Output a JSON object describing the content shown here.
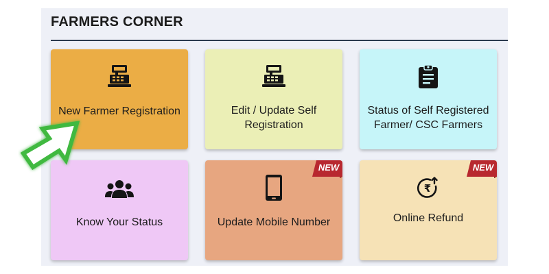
{
  "header": {
    "title": "FARMERS CORNER"
  },
  "tiles": [
    {
      "label": "New Farmer Registration",
      "icon": "cash-register-icon",
      "color": "#ebad45"
    },
    {
      "label": "Edit / Update Self Registration",
      "icon": "cash-register-icon",
      "color": "#ebefb6"
    },
    {
      "label": "Status of Self Registered Farmer/ CSC Farmers",
      "icon": "clipboard-icon",
      "color": "#c6f5f9"
    },
    {
      "label": "Know Your Status",
      "icon": "users-icon",
      "color": "#efc8f6"
    },
    {
      "label": "Update Mobile Number",
      "icon": "mobile-phone-icon",
      "color": "#e7a680",
      "badge": "NEW"
    },
    {
      "label": "Online Refund",
      "icon": "rupee-refund-icon",
      "color": "#f6e2b6",
      "badge": "NEW"
    }
  ],
  "colors": {
    "panel_bg": "#eef0f7",
    "header_rule": "#2b3a4f",
    "badge_red": "#b8282f",
    "arrow_green": "#3fb940"
  }
}
